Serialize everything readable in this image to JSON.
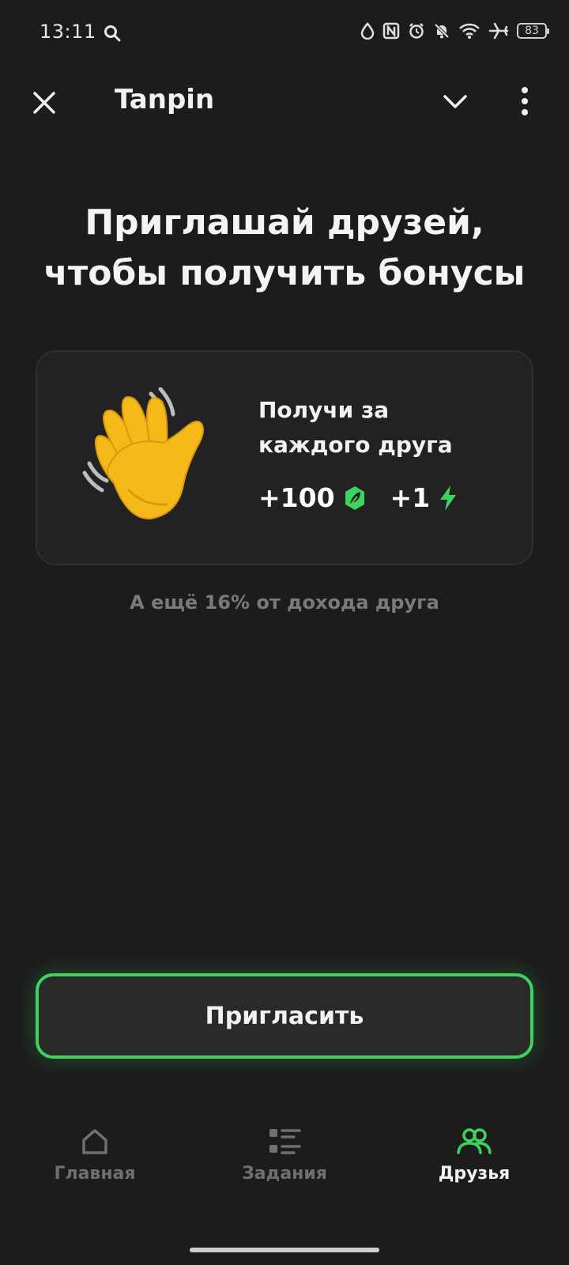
{
  "status_bar": {
    "time": "13:11",
    "battery": "83"
  },
  "app_bar": {
    "title": "Tanpin"
  },
  "headline": {
    "line1": "Приглашай друзей,",
    "line2": "чтобы получить бонусы"
  },
  "reward_card": {
    "text_line1": "Получи за",
    "text_line2": "каждого друга",
    "coins_value": "+100",
    "energy_value": "+1",
    "accent_color": "#3ed35f"
  },
  "note": "А ещё 16% от дохода друга",
  "invite_button": {
    "label": "Пригласить",
    "border_color": "#3ed35f"
  },
  "tabs": [
    {
      "label": "Главная",
      "icon": "home-icon",
      "active": false
    },
    {
      "label": "Задания",
      "icon": "tasks-list-icon",
      "active": false
    },
    {
      "label": "Друзья",
      "icon": "friends-icon",
      "active": true
    }
  ]
}
